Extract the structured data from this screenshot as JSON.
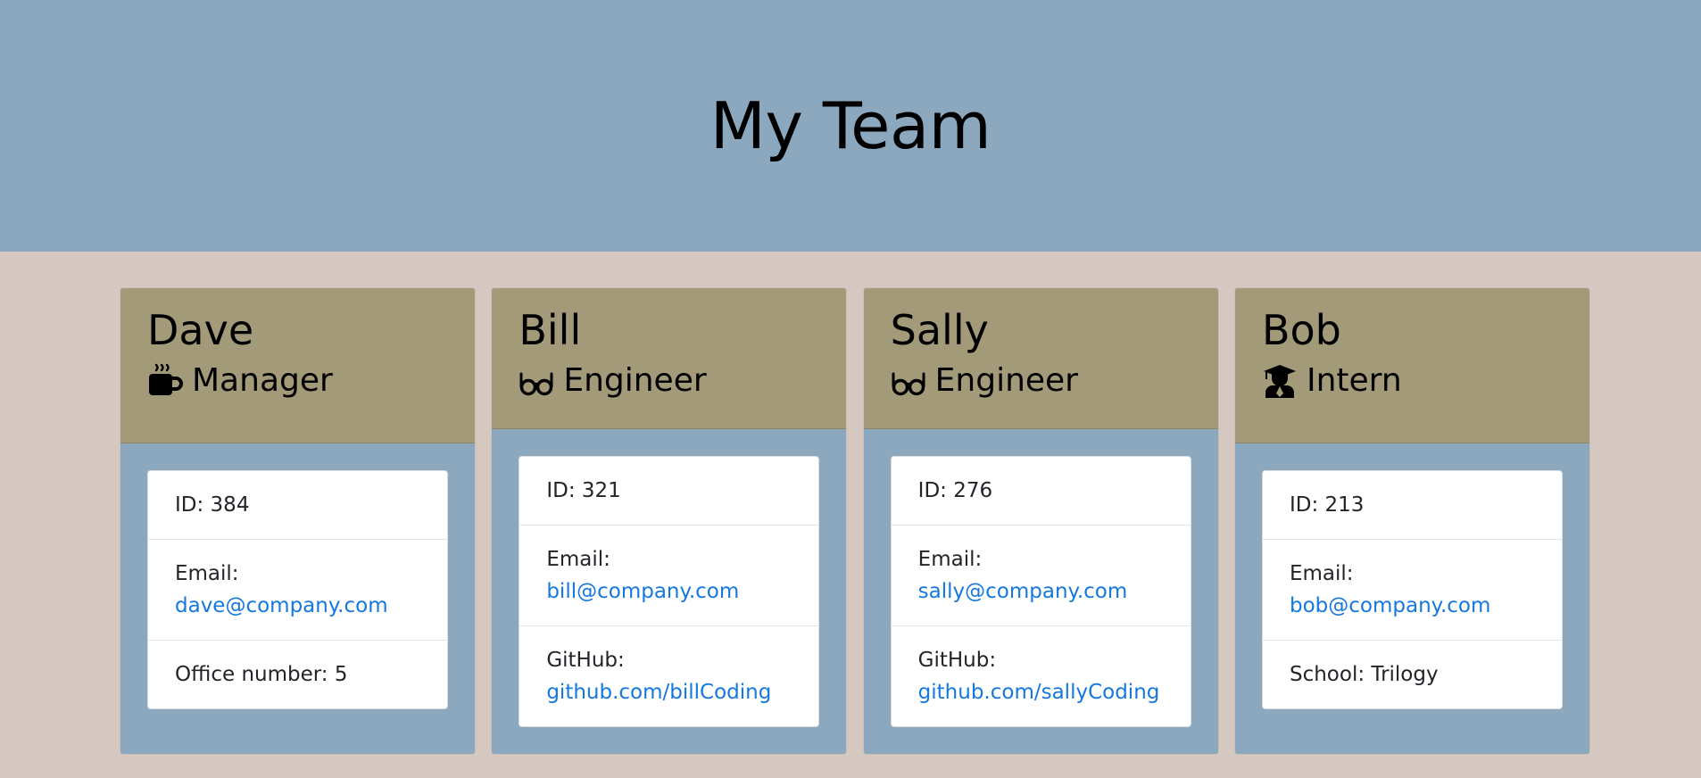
{
  "header": {
    "title": "My Team"
  },
  "team": [
    {
      "name": "Dave",
      "role": "Manager",
      "role_icon": "coffee-mug-icon",
      "id_label": "ID: 384",
      "email_label": "Email:",
      "email": "dave@company.com",
      "extra_label": "Office number: 5",
      "extra_link": ""
    },
    {
      "name": "Bill",
      "role": "Engineer",
      "role_icon": "glasses-icon",
      "id_label": "ID: 321",
      "email_label": "Email:",
      "email": "bill@company.com",
      "extra_label": "GitHub:",
      "extra_link": "github.com/billCoding"
    },
    {
      "name": "Sally",
      "role": "Engineer",
      "role_icon": "glasses-icon",
      "id_label": "ID: 276",
      "email_label": "Email:",
      "email": "sally@company.com",
      "extra_label": "GitHub:",
      "extra_link": "github.com/sallyCoding"
    },
    {
      "name": "Bob",
      "role": "Intern",
      "role_icon": "graduate-icon",
      "id_label": "ID: 213",
      "email_label": "Email:",
      "email": "bob@company.com",
      "extra_label": "School: Trilogy",
      "extra_link": ""
    }
  ],
  "colors": {
    "hero_bg": "#8ca8bf",
    "page_bg": "#d4c8c0",
    "card_header_bg": "#a39a7a",
    "card_body_bg": "#8ca8bf",
    "link": "#1478e0"
  }
}
